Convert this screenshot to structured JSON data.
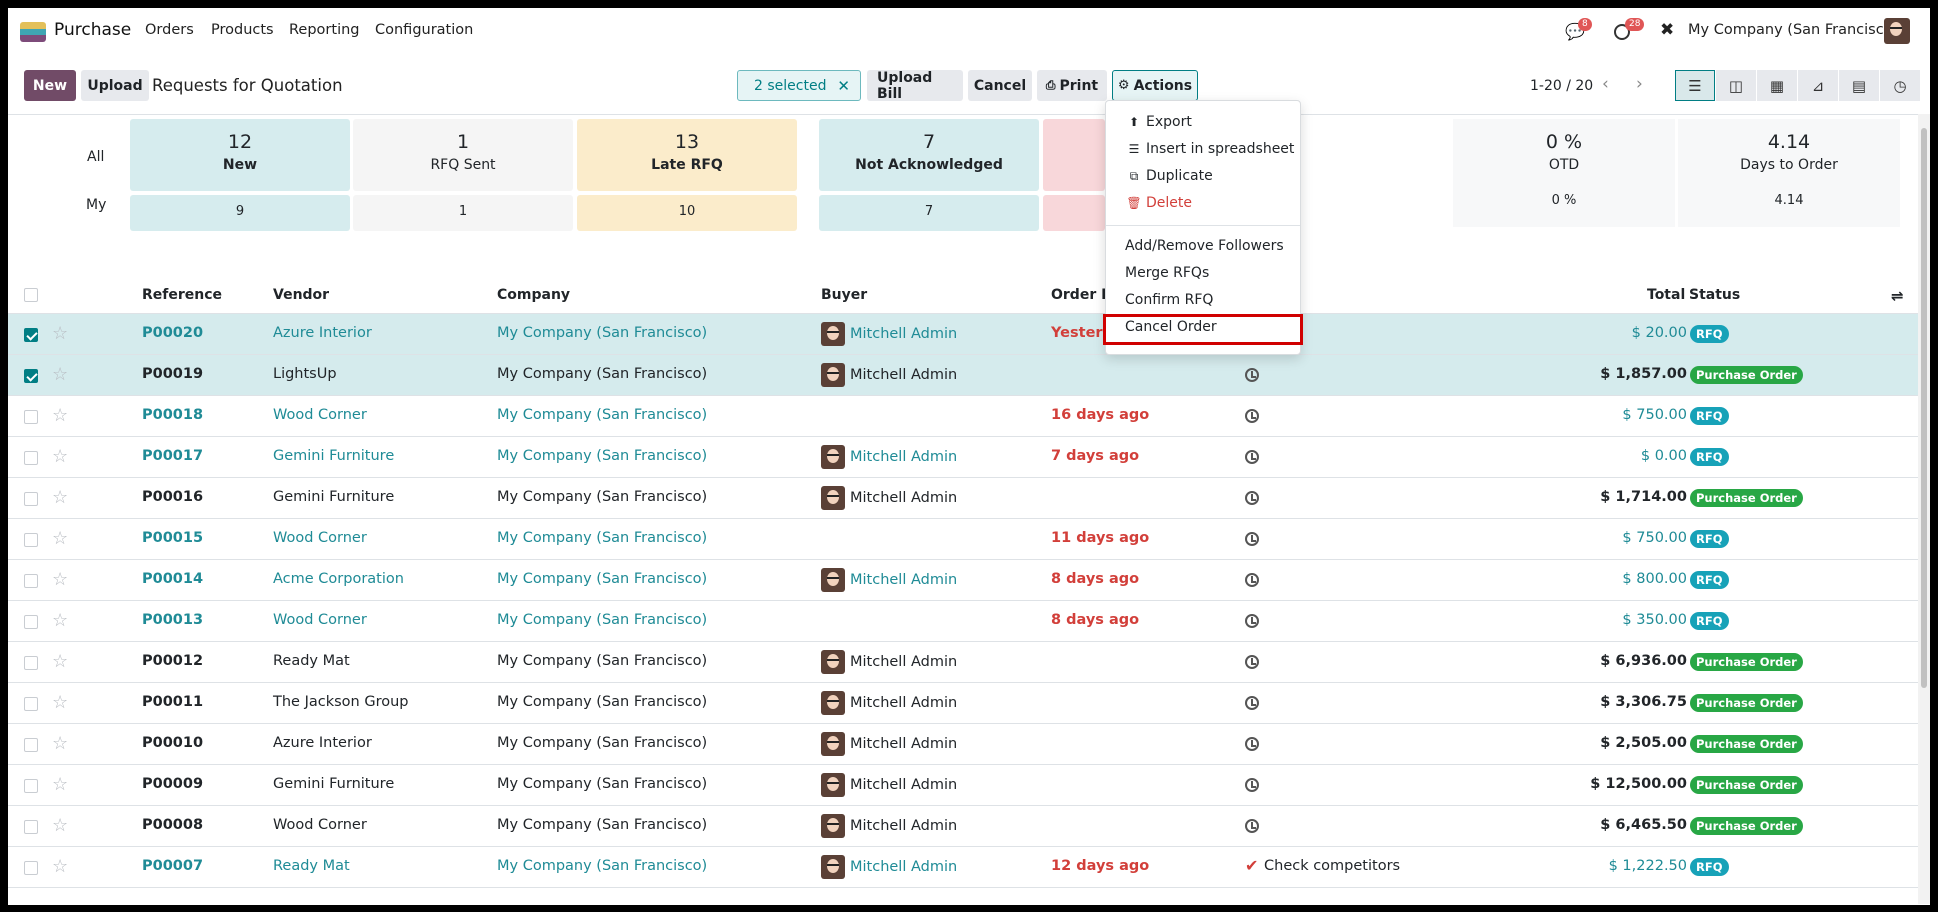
{
  "nav": {
    "app": "Purchase",
    "menu": [
      "Orders",
      "Products",
      "Reporting",
      "Configuration"
    ],
    "chat_badge": "8",
    "activity_badge": "28",
    "company": "My Company (San Francisco)"
  },
  "controls": {
    "new": "New",
    "upload": "Upload",
    "title": "Requests for Quotation",
    "selected": "2 selected",
    "upload_bill": "Upload Bill",
    "cancel": "Cancel",
    "print": "Print",
    "actions": "Actions",
    "pager": "1-20 / 20"
  },
  "actions_menu": {
    "export": "Export",
    "insert": "Insert in spreadsheet",
    "duplicate": "Duplicate",
    "delete": "Delete",
    "followers": "Add/Remove Followers",
    "merge": "Merge RFQs",
    "confirm": "Confirm RFQ",
    "cancel_order": "Cancel Order"
  },
  "dashboard": {
    "all_label": "All",
    "my_label": "My",
    "tiles": [
      {
        "num": "12",
        "label": "New",
        "my": "9"
      },
      {
        "num": "1",
        "label": "RFQ Sent",
        "my": "1"
      },
      {
        "num": "13",
        "label": "Late RFQ",
        "my": "10"
      },
      {
        "num": "7",
        "label": "Not Acknowledged",
        "my": "7"
      }
    ],
    "otd": {
      "num": "0 %",
      "label": "OTD",
      "my": "0 %"
    },
    "days": {
      "num": "4.14",
      "label": "Days to Order",
      "my": "4.14"
    }
  },
  "columns": {
    "reference": "Reference",
    "vendor": "Vendor",
    "company": "Company",
    "buyer": "Buyer",
    "order_deadline": "Order De",
    "total": "Total",
    "status": "Status"
  },
  "rows": [
    {
      "ref": "P00020",
      "vendor": "Azure Interior",
      "company": "My Company (San Francisco)",
      "buyer": "Mitchell Admin",
      "deadline": "Yesterd",
      "total": "$ 20.00",
      "status": "RFQ"
    },
    {
      "ref": "P00019",
      "vendor": "LightsUp",
      "company": "My Company (San Francisco)",
      "buyer": "Mitchell Admin",
      "deadline": "",
      "total": "$ 1,857.00",
      "status": "Purchase Order"
    },
    {
      "ref": "P00018",
      "vendor": "Wood Corner",
      "company": "My Company (San Francisco)",
      "buyer": "",
      "deadline": "16 days ago",
      "total": "$ 750.00",
      "status": "RFQ"
    },
    {
      "ref": "P00017",
      "vendor": "Gemini Furniture",
      "company": "My Company (San Francisco)",
      "buyer": "Mitchell Admin",
      "deadline": "7 days ago",
      "total": "$ 0.00",
      "status": "RFQ"
    },
    {
      "ref": "P00016",
      "vendor": "Gemini Furniture",
      "company": "My Company (San Francisco)",
      "buyer": "Mitchell Admin",
      "deadline": "",
      "total": "$ 1,714.00",
      "status": "Purchase Order"
    },
    {
      "ref": "P00015",
      "vendor": "Wood Corner",
      "company": "My Company (San Francisco)",
      "buyer": "",
      "deadline": "11 days ago",
      "total": "$ 750.00",
      "status": "RFQ"
    },
    {
      "ref": "P00014",
      "vendor": "Acme Corporation",
      "company": "My Company (San Francisco)",
      "buyer": "Mitchell Admin",
      "deadline": "8 days ago",
      "total": "$ 800.00",
      "status": "RFQ"
    },
    {
      "ref": "P00013",
      "vendor": "Wood Corner",
      "company": "My Company (San Francisco)",
      "buyer": "",
      "deadline": "8 days ago",
      "total": "$ 350.00",
      "status": "RFQ"
    },
    {
      "ref": "P00012",
      "vendor": "Ready Mat",
      "company": "My Company (San Francisco)",
      "buyer": "Mitchell Admin",
      "deadline": "",
      "total": "$ 6,936.00",
      "status": "Purchase Order"
    },
    {
      "ref": "P00011",
      "vendor": "The Jackson Group",
      "company": "My Company (San Francisco)",
      "buyer": "Mitchell Admin",
      "deadline": "",
      "total": "$ 3,306.75",
      "status": "Purchase Order"
    },
    {
      "ref": "P00010",
      "vendor": "Azure Interior",
      "company": "My Company (San Francisco)",
      "buyer": "Mitchell Admin",
      "deadline": "",
      "total": "$ 2,505.00",
      "status": "Purchase Order"
    },
    {
      "ref": "P00009",
      "vendor": "Gemini Furniture",
      "company": "My Company (San Francisco)",
      "buyer": "Mitchell Admin",
      "deadline": "",
      "total": "$ 12,500.00",
      "status": "Purchase Order"
    },
    {
      "ref": "P00008",
      "vendor": "Wood Corner",
      "company": "My Company (San Francisco)",
      "buyer": "Mitchell Admin",
      "deadline": "",
      "total": "$ 6,465.50",
      "status": "Purchase Order"
    },
    {
      "ref": "P00007",
      "vendor": "Ready Mat",
      "company": "My Company (San Francisco)",
      "buyer": "Mitchell Admin",
      "deadline": "12 days ago",
      "activity": "Check competitors",
      "total": "$ 1,222.50",
      "status": "RFQ"
    }
  ]
}
